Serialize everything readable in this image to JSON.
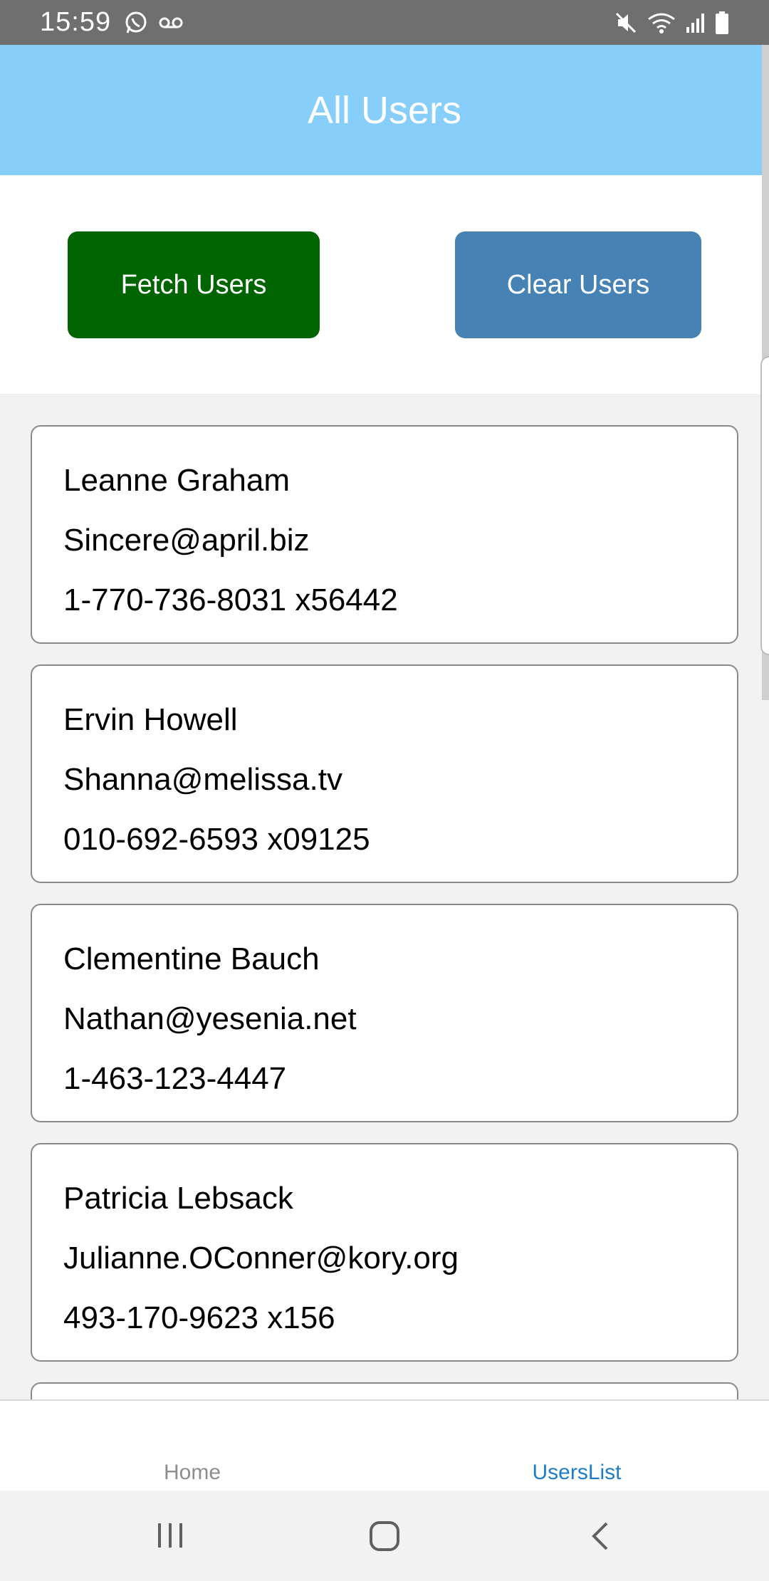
{
  "status_bar": {
    "time": "15:59",
    "icons_left": [
      "whatsapp-icon",
      "voicemail-icon"
    ],
    "icons_right": [
      "mute-icon",
      "wifi-icon",
      "signal-icon",
      "battery-icon"
    ]
  },
  "header": {
    "title": "All Users"
  },
  "actions": {
    "fetch_label": "Fetch Users",
    "clear_label": "Clear Users"
  },
  "colors": {
    "header_bg": "#87cefa",
    "fetch_bg": "#006400",
    "clear_bg": "#4682b4",
    "active_tab": "#1f7ccc"
  },
  "users": [
    {
      "name": "Leanne Graham",
      "email": "Sincere@april.biz",
      "phone": "1-770-736-8031 x56442"
    },
    {
      "name": "Ervin Howell",
      "email": "Shanna@melissa.tv",
      "phone": "010-692-6593 x09125"
    },
    {
      "name": "Clementine Bauch",
      "email": "Nathan@yesenia.net",
      "phone": "1-463-123-4447"
    },
    {
      "name": "Patricia Lebsack",
      "email": "Julianne.OConner@kory.org",
      "phone": "493-170-9623 x156"
    }
  ],
  "tabs": [
    {
      "label": "Home",
      "active": false
    },
    {
      "label": "UsersList",
      "active": true
    }
  ],
  "system_nav": [
    "recent-apps-icon",
    "home-icon",
    "back-icon"
  ]
}
